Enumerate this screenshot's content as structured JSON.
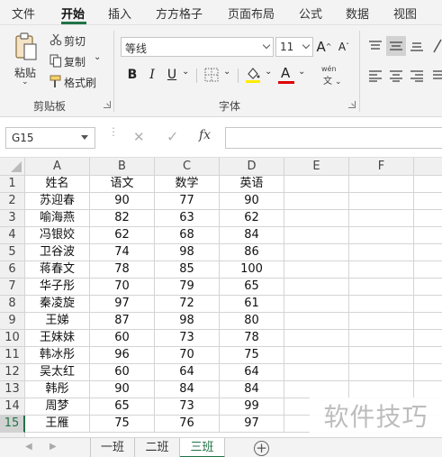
{
  "menu": {
    "tabs": [
      {
        "label": "文件"
      },
      {
        "label": "开始"
      },
      {
        "label": "插入"
      },
      {
        "label": "方方格子"
      },
      {
        "label": "页面布局"
      },
      {
        "label": "公式"
      },
      {
        "label": "数据"
      },
      {
        "label": "视图"
      }
    ],
    "active_tab": "开始"
  },
  "clipboard": {
    "paste": "粘贴",
    "cut": "剪切",
    "copy": "复制",
    "format_painter": "格式刷",
    "group_label": "剪贴板"
  },
  "font": {
    "name": "等线",
    "size": "11",
    "bold": "B",
    "italic": "I",
    "underline": "U",
    "grow": "A",
    "shrink": "A",
    "font_color_glyph": "A",
    "phonetic_top": "wén",
    "phonetic_bottom": "文",
    "group_label": "字体"
  },
  "colors": {
    "accent": "#217346",
    "highlight": "#ffeb00",
    "font_color": "#e00000"
  },
  "formula_bar": {
    "name_box": "G15",
    "cancel": "✕",
    "confirm": "✓",
    "fx": "fx",
    "value": ""
  },
  "grid": {
    "columns": [
      "A",
      "B",
      "C",
      "D",
      "E",
      "F"
    ],
    "rows": [
      {
        "n": "1",
        "cells": [
          "姓名",
          "语文",
          "数学",
          "英语"
        ]
      },
      {
        "n": "2",
        "cells": [
          "苏迎春",
          "90",
          "77",
          "90"
        ]
      },
      {
        "n": "3",
        "cells": [
          "喻海燕",
          "82",
          "63",
          "62"
        ]
      },
      {
        "n": "4",
        "cells": [
          "冯银姣",
          "62",
          "68",
          "84"
        ]
      },
      {
        "n": "5",
        "cells": [
          "卫谷波",
          "74",
          "98",
          "86"
        ]
      },
      {
        "n": "6",
        "cells": [
          "蒋春文",
          "78",
          "85",
          "100"
        ]
      },
      {
        "n": "7",
        "cells": [
          "华子彤",
          "70",
          "79",
          "65"
        ]
      },
      {
        "n": "8",
        "cells": [
          "秦凌旋",
          "97",
          "72",
          "61"
        ]
      },
      {
        "n": "9",
        "cells": [
          "王娣",
          "87",
          "98",
          "80"
        ]
      },
      {
        "n": "10",
        "cells": [
          "王妹妹",
          "60",
          "73",
          "78"
        ]
      },
      {
        "n": "11",
        "cells": [
          "韩冰彤",
          "96",
          "70",
          "75"
        ]
      },
      {
        "n": "12",
        "cells": [
          "吴太红",
          "60",
          "64",
          "64"
        ]
      },
      {
        "n": "13",
        "cells": [
          "韩彤",
          "90",
          "84",
          "84"
        ]
      },
      {
        "n": "14",
        "cells": [
          "周梦",
          "65",
          "73",
          "99"
        ]
      },
      {
        "n": "15",
        "cells": [
          "王雁",
          "75",
          "76",
          "97"
        ]
      }
    ],
    "selected_row": "15"
  },
  "sheets": {
    "tabs": [
      "一班",
      "二班",
      "三班"
    ],
    "active": "三班",
    "add": "+"
  },
  "watermark": "软件技巧"
}
